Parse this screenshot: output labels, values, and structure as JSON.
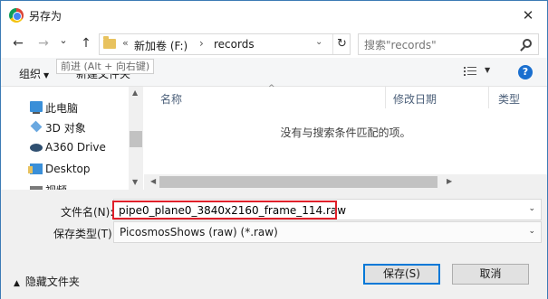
{
  "window": {
    "title": "另存为",
    "close_glyph": "✕"
  },
  "nav": {
    "back_glyph": "←",
    "forward_glyph": "→",
    "recent_glyph": "⌄",
    "up_glyph": "↑",
    "chevrons": "«",
    "drive": "新加卷 (F:)",
    "separator": "›",
    "folder": "records",
    "address_dropdown": "⌄",
    "refresh_glyph": "↻",
    "search_placeholder": "搜索\"records\""
  },
  "toolbar": {
    "organize": "组织",
    "organize_caret": "▼",
    "new_folder": "新建文件夹",
    "tooltip": "前进 (Alt + 向右键)",
    "view_caret": "▼",
    "help": "?"
  },
  "tree": {
    "scroll_up": "▲",
    "scroll_down": "▼",
    "items": [
      {
        "label": "此电脑",
        "icon": "computer-icon"
      },
      {
        "label": "3D 对象",
        "icon": "cube-icon"
      },
      {
        "label": "A360 Drive",
        "icon": "cloud-drive-icon"
      },
      {
        "label": "Desktop",
        "icon": "desktop-icon"
      },
      {
        "label": "视频",
        "icon": "video-icon"
      }
    ]
  },
  "filelist": {
    "columns": [
      "名称",
      "修改日期",
      "类型"
    ],
    "sort_arrow": "^",
    "empty_message": "没有与搜索条件匹配的项。",
    "scroll_left": "◀",
    "scroll_right": "▶"
  },
  "save": {
    "filename_label": "文件名(N):",
    "filename_value": "pipe0_plane0_3840x2160_frame_114.raw",
    "filename_dropdown": "⌄",
    "filetype_label": "保存类型(T):",
    "filetype_value": "PicosmosShows (raw) (*.raw)",
    "filetype_dropdown": "⌄",
    "hide_folders_caret": "▲",
    "hide_folders": "隐藏文件夹",
    "save_button": "保存(S)",
    "cancel_button": "取消"
  },
  "colors": {
    "accent": "#0078d7",
    "highlight_border": "#e0202a",
    "help_blue": "#1a6fcf"
  }
}
